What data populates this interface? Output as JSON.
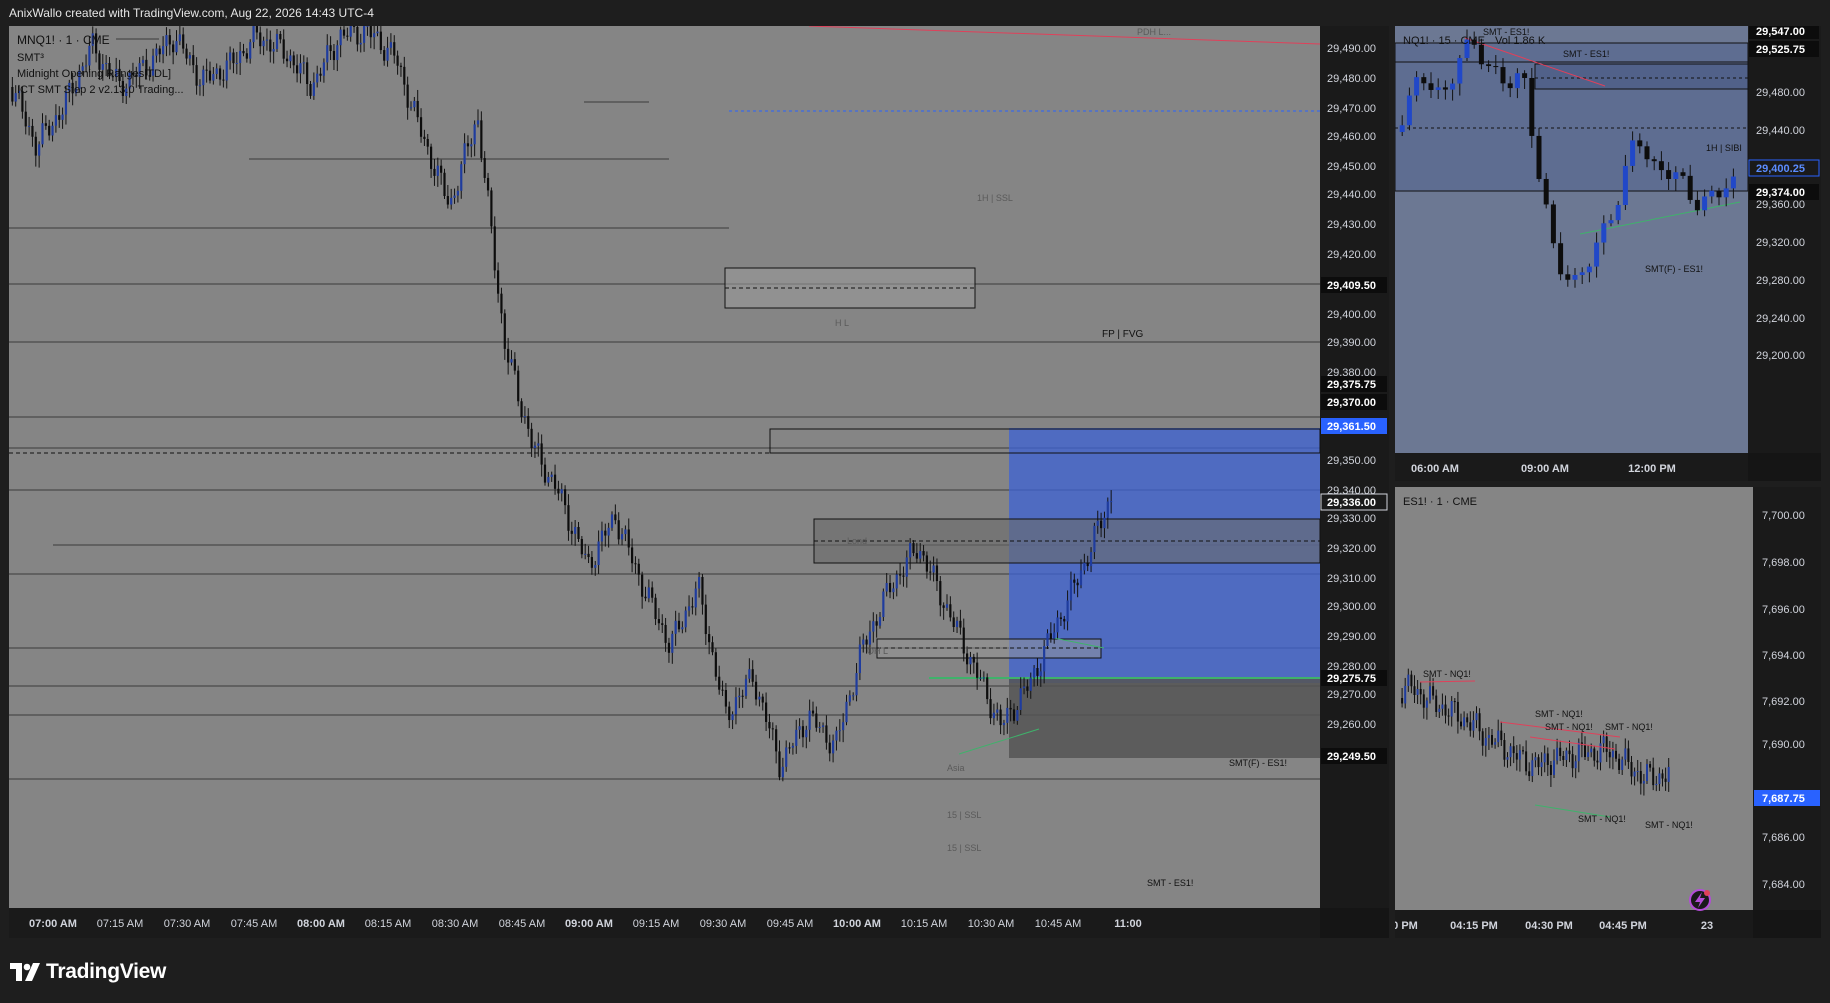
{
  "header": {
    "attribution": "AnixWallo created with TradingView.com, Aug 22, 2026 14:43 UTC-4"
  },
  "brand": {
    "name": "TradingView"
  },
  "colors": {
    "chart_bg": "#858585",
    "candle_up": "#1f3c9e",
    "candle_down": "#0d0d0d",
    "price_tag_active": "#2962ff",
    "smt_bear": "#e0405a",
    "smt_bull": "#3fb26b",
    "zone_blue": "#3d63d6"
  },
  "main_chart": {
    "symbol": "MNQ1! · 1 · CME",
    "indicators": [
      "SMT³",
      "Midnight Opening Ranges[TDL]",
      "ICT SMT Step 2 v2.13.0 Trading..."
    ],
    "price_axis": [
      "29,490.00",
      "29,480.00",
      "29,470.00",
      "29,460.00",
      "29,450.00",
      "29,440.00",
      "29,430.00",
      "29,420.00",
      "29,400.00",
      "29,390.00",
      "29,380.00",
      "29,350.00",
      "29,340.00",
      "29,330.00",
      "29,320.00",
      "29,310.00",
      "29,300.00",
      "29,290.00",
      "29,280.00",
      "29,270.00",
      "29,260.00"
    ],
    "price_tags": [
      {
        "label": "29,409.50",
        "style": "dark"
      },
      {
        "label": "29,375.75",
        "style": "dark"
      },
      {
        "label": "29,370.00",
        "style": "dark"
      },
      {
        "label": "29,361.50",
        "style": "blue"
      },
      {
        "label": "29,336.00",
        "style": "outline"
      },
      {
        "label": "29,275.75",
        "style": "dark"
      },
      {
        "label": "29,249.50",
        "style": "dark"
      }
    ],
    "time_axis": [
      "07:00 AM",
      "07:15 AM",
      "07:30 AM",
      "07:45 AM",
      "08:00 AM",
      "08:15 AM",
      "08:30 AM",
      "08:45 AM",
      "09:00 AM",
      "09:15 AM",
      "09:30 AM",
      "09:45 AM",
      "10:00 AM",
      "10:15 AM",
      "10:30 AM",
      "10:45 AM",
      "11:00"
    ],
    "bold_times": [
      "07:00 AM",
      "08:00 AM",
      "09:00 AM",
      "10:00 AM",
      "11:00"
    ],
    "annotations": {
      "ssl_1h": "1H | SSL",
      "fp_fvg": "FP | FVG",
      "lond": "Lond",
      "oh_l": "OH L",
      "asia": "Asia",
      "ssl_15a": "15 | SSL",
      "ssl_15b": "15 | SSL",
      "smt_f_es": "SMT(F) - ES1!",
      "smt_es": "SMT - ES1!",
      "h_l": "H L",
      "pdh": "PDH L..."
    }
  },
  "nq_chart": {
    "symbol": "NQ1! · 15 · CME",
    "volume": "Vol 1.86 K",
    "price_axis": [
      "29,480.00",
      "29,440.00",
      "29,360.00",
      "29,320.00",
      "29,280.00",
      "29,240.00",
      "29,200.00"
    ],
    "price_tags": [
      {
        "label": "29,547.00",
        "style": "dark"
      },
      {
        "label": "29,525.75",
        "style": "dark"
      },
      {
        "label": "29,400.25",
        "style": "outline-blue"
      },
      {
        "label": "29,374.00",
        "style": "dark"
      }
    ],
    "time_axis": [
      "06:00 AM",
      "09:00 AM",
      "12:00 PM"
    ],
    "annotations": {
      "smt_es_top": "SMT - ES1!",
      "smt_es_mid": "SMT - ES1!",
      "sibi": "1H | SIBI",
      "smt_f_es": "SMT(F) - ES1!"
    }
  },
  "es_chart": {
    "symbol": "ES1! · 1 · CME",
    "price_axis": [
      "7,700.00",
      "7,698.00",
      "7,696.00",
      "7,694.00",
      "7,692.00",
      "7,690.00",
      "7,686.00",
      "7,684.00"
    ],
    "price_tags": [
      {
        "label": "7,687.75",
        "style": "blue"
      }
    ],
    "time_axis": [
      "0 PM",
      "04:15 PM",
      "04:30 PM",
      "04:45 PM",
      "23"
    ],
    "annotations": [
      "SMT - NQ1!",
      "SMT - NQ1!",
      "SMT - NQ1!",
      "SMT - NQ1!",
      "SMT - NQ1!",
      "SMT - NQ1!"
    ]
  }
}
